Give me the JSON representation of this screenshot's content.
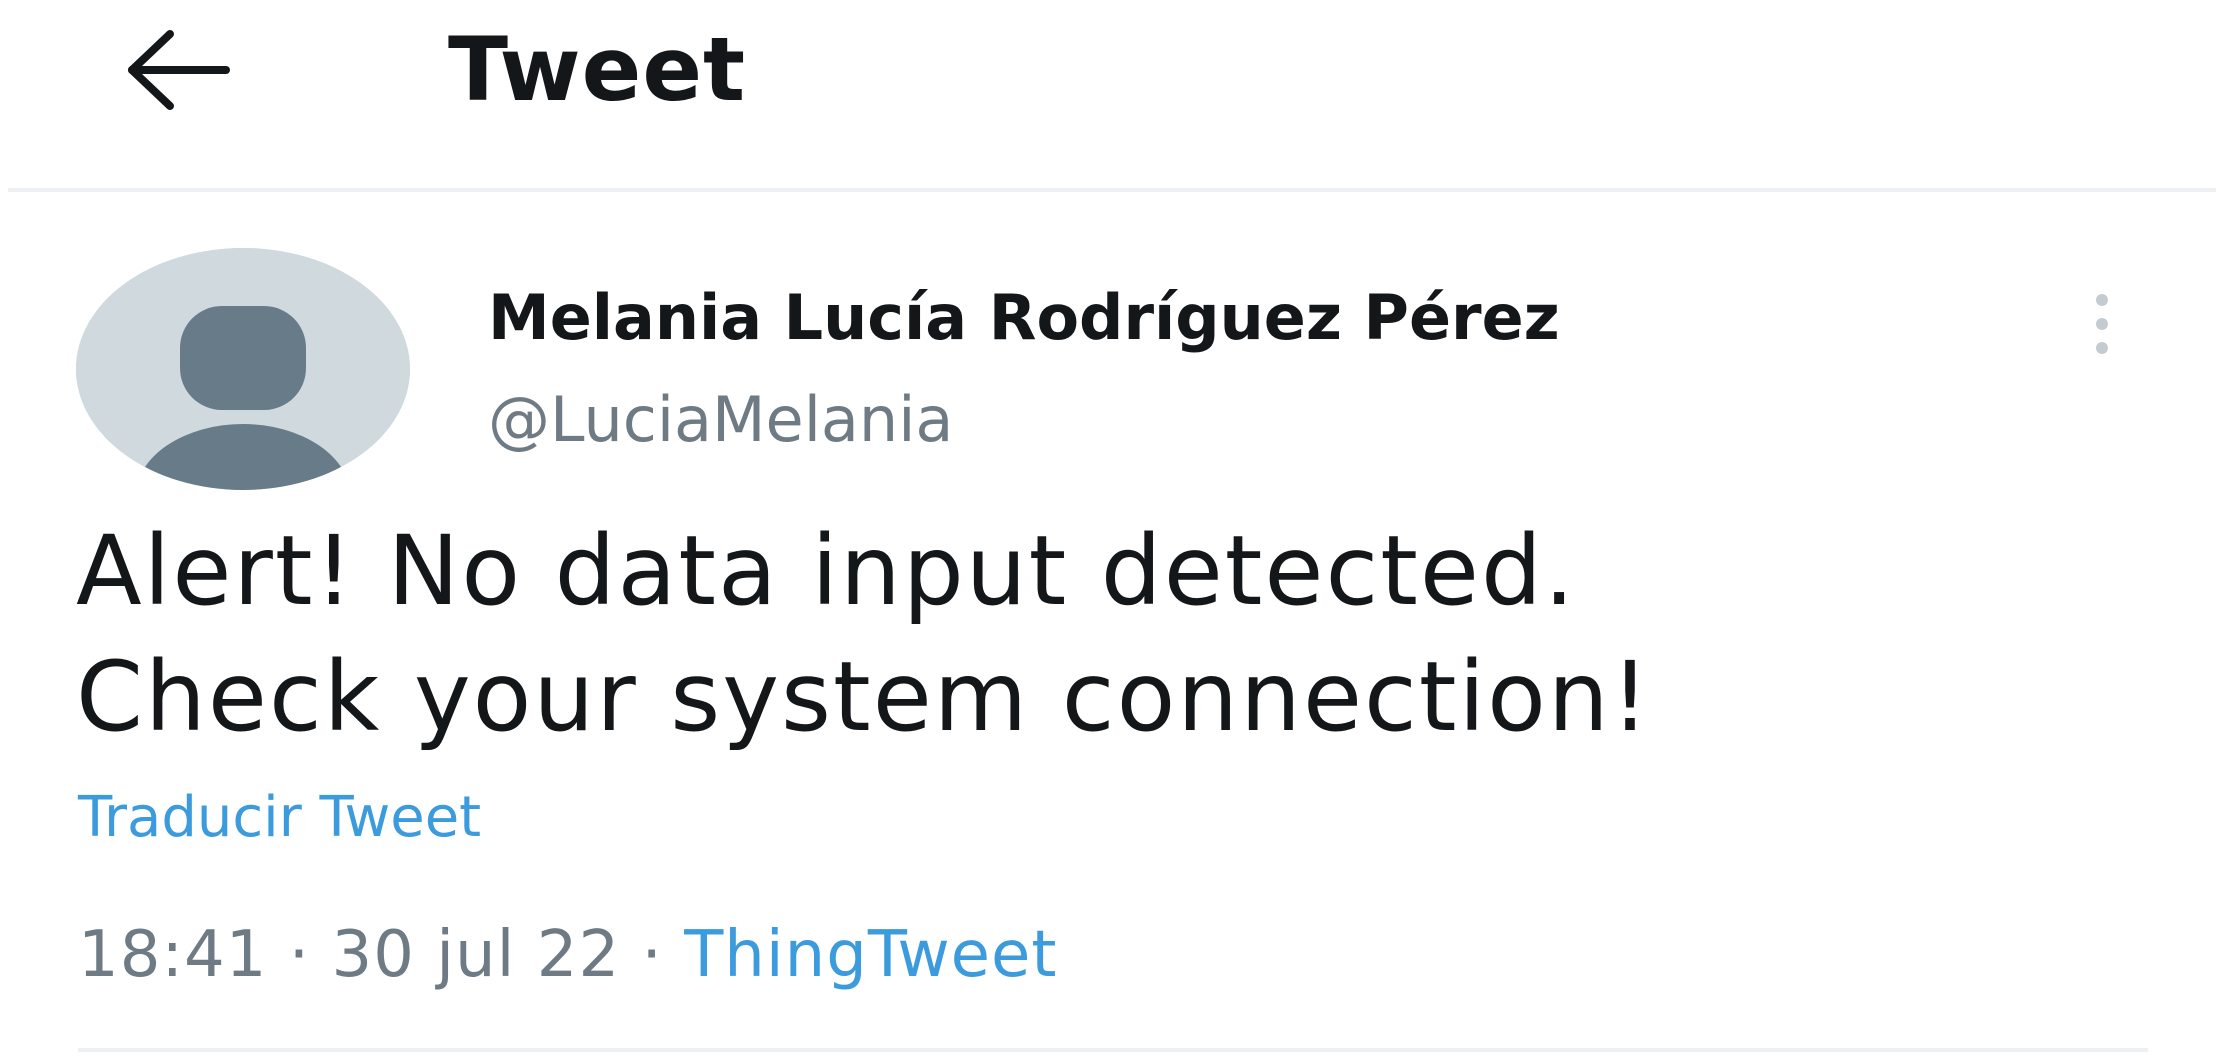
{
  "header": {
    "back_icon": "arrow-left-icon",
    "title": "Tweet"
  },
  "tweet": {
    "author": {
      "display_name": "Melania Lucía Rodríguez Pérez",
      "handle": "@LuciaMelania",
      "avatar_icon": "default-user-avatar-icon"
    },
    "more_icon": "vertical-ellipsis-icon",
    "text_line_1": "Alert! No data input detected.",
    "text_line_2": "Check your system connection!",
    "translate_label": "Traducir Tweet",
    "time": "18:41",
    "date": "30 jul 22",
    "separator": "·",
    "source": "ThingTweet"
  },
  "colors": {
    "text_primary": "#14171a",
    "text_secondary": "#6e7b85",
    "link": "#3c9bdc",
    "avatar_bg": "#cfd9de",
    "avatar_figure": "#687b89",
    "divider": "#eef1f3"
  }
}
